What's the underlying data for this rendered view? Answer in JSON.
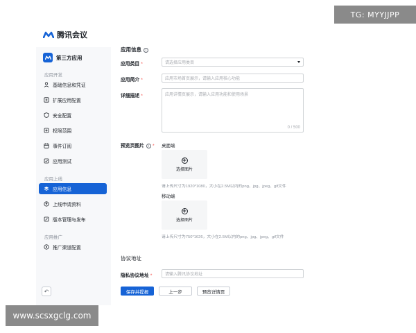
{
  "watermarks": {
    "top_right": "TG: MYYJJPP",
    "bottom_left": "www.scsxgclg.com"
  },
  "brand": {
    "name": "腾讯会议"
  },
  "sidebar": {
    "app_title": "第三方应用",
    "groups": [
      {
        "title": "应用开发",
        "items": [
          {
            "label": "基础信息和凭证",
            "icon": "person-icon"
          },
          {
            "label": "扩展应用配置",
            "icon": "extension-icon"
          },
          {
            "label": "安全配置",
            "icon": "shield-icon"
          },
          {
            "label": "权限范围",
            "icon": "key-icon"
          },
          {
            "label": "事件订阅",
            "icon": "calendar-icon"
          },
          {
            "label": "应用测试",
            "icon": "test-icon"
          }
        ]
      },
      {
        "title": "应用上线",
        "items": [
          {
            "label": "应用信息",
            "icon": "app-stack-icon",
            "active": true
          },
          {
            "label": "上线申请资料",
            "icon": "upload-icon"
          },
          {
            "label": "版本管理与发布",
            "icon": "version-icon"
          }
        ]
      },
      {
        "title": "应用推广",
        "items": [
          {
            "label": "推广渠道配置",
            "icon": "promote-icon"
          }
        ]
      }
    ]
  },
  "form": {
    "section_title": "应用信息",
    "category": {
      "label": "应用类目",
      "required_mark": "*",
      "placeholder": "请选择应用类目"
    },
    "intro": {
      "label": "应用简介",
      "required_mark": "*",
      "placeholder": "应用市场首页展示，请输入应用核心功能"
    },
    "detail": {
      "label": "详细描述",
      "required_mark": "*",
      "placeholder": "应用详情页展示，请输入应用功能和使用场景",
      "counter": "0 / 500"
    },
    "preview": {
      "label": "预览页图片",
      "desktop": {
        "title": "桌面端",
        "upload_label": "选择图片",
        "hint": "请上传尺寸为1920*1080，大小在2.5M以内的png、jpg、jpeg、gif文件"
      },
      "mobile": {
        "title": "移动端",
        "upload_label": "选择图片",
        "hint": "请上传尺寸为750*1626，大小在2.5M以内的png、jpg、jpeg、gif文件"
      }
    },
    "protocol_section_title": "协议地址",
    "privacy": {
      "label": "隐私协议地址",
      "required_mark": "*",
      "placeholder": "请输入腾讯协议地址"
    }
  },
  "actions": {
    "save": "保存并提报",
    "prev": "上一步",
    "preview": "预览详情页"
  },
  "colors": {
    "primary": "#1663d6",
    "sidebar_bg": "#f7f8fa",
    "required": "#f54a45"
  }
}
